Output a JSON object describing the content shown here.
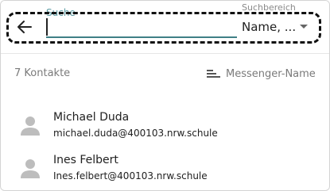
{
  "header": {
    "search_label": "Suche",
    "search_value": "",
    "scope_label": "Suchbereich",
    "scope_value": "Name, ..."
  },
  "toolbar": {
    "count_text": "7 Kontakte",
    "sort_label": "Messenger-Name"
  },
  "contacts": [
    {
      "name": "Michael Duda",
      "email": "michael.duda@400103.nrw.schule"
    },
    {
      "name": "Ines Felbert",
      "email": "Ines.felbert@400103.nrw.schule"
    }
  ],
  "icons": {
    "back": "arrow-left-icon",
    "dropdown": "caret-down-icon",
    "sort": "sort-lines-icon",
    "avatar": "person-icon"
  },
  "colors": {
    "accent": "#3f7f86",
    "label_accent": "#5d9ca4",
    "muted_text": "#7a7a7a",
    "avatar": "#bdbdbd"
  }
}
